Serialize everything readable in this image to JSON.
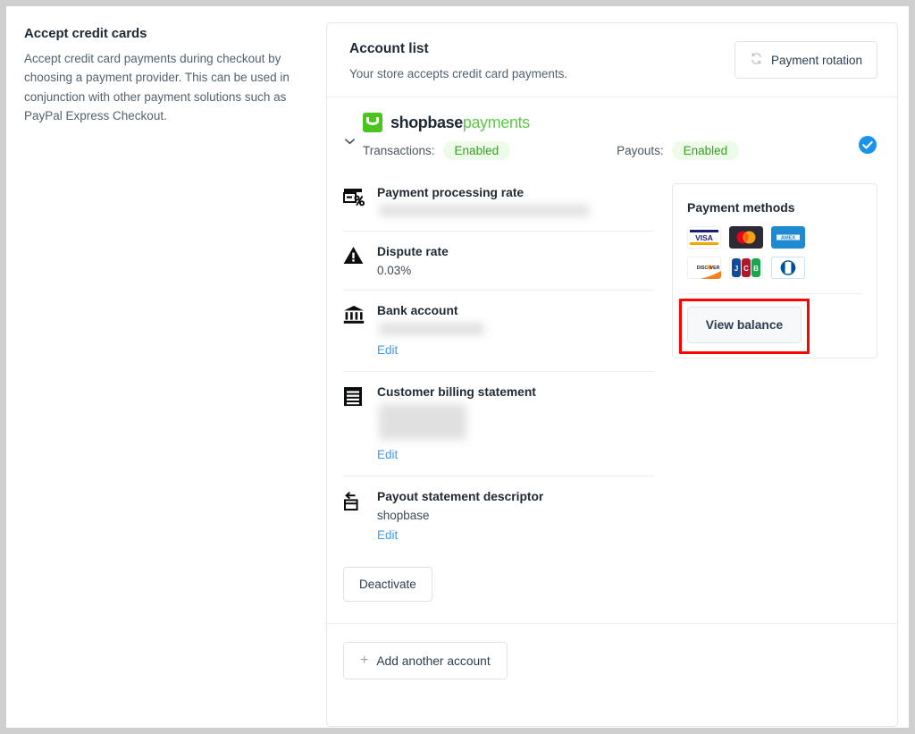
{
  "sidebar": {
    "title": "Accept credit cards",
    "description": "Accept credit card payments during checkout by choosing a payment provider. This can be used in conjunction with other payment solutions such as PayPal Express Checkout."
  },
  "account_list": {
    "title": "Account list",
    "subtitle": "Your store accepts credit card payments.",
    "rotation_button": "Payment rotation",
    "rotation_icon": "rotate-icon"
  },
  "provider": {
    "collapse_icon": "chevron-down-icon",
    "logo_icon": "shopbase-logo-icon",
    "name_bold": "shopbase",
    "name_light": "payments",
    "transactions_label": "Transactions:",
    "transactions_status": "Enabled",
    "payouts_label": "Payouts:",
    "payouts_status": "Enabled",
    "verified_icon": "verified-check-icon",
    "status_color": "#3a9b27",
    "status_bg": "#eefbe9",
    "brand_green": "#4cc420",
    "verified_blue": "#1a94e8"
  },
  "details": [
    {
      "icon": "card-percent-icon",
      "title": "Payment processing rate",
      "value": "",
      "redacted": true,
      "edit": null
    },
    {
      "icon": "warning-triangle-icon",
      "title": "Dispute rate",
      "value": "0.03%",
      "redacted": false,
      "edit": null
    },
    {
      "icon": "bank-icon",
      "title": "Bank account",
      "value": "",
      "redacted": true,
      "edit": "Edit"
    },
    {
      "icon": "receipt-icon",
      "title": "Customer billing statement",
      "value": "",
      "redacted": true,
      "edit": "Edit"
    },
    {
      "icon": "card-return-icon",
      "title": "Payout statement descriptor",
      "value": "shopbase",
      "redacted": false,
      "edit": "Edit"
    }
  ],
  "payment_methods": {
    "title": "Payment methods",
    "brands": [
      "visa",
      "mastercard",
      "amex",
      "discover",
      "jcb",
      "diners-club"
    ],
    "view_balance_button": "View balance",
    "highlight_color": "#ff0000"
  },
  "footer": {
    "deactivate_button": "Deactivate",
    "add_account_button": "Add another account",
    "add_icon": "plus-icon"
  },
  "link_color": "#3e9ae8"
}
